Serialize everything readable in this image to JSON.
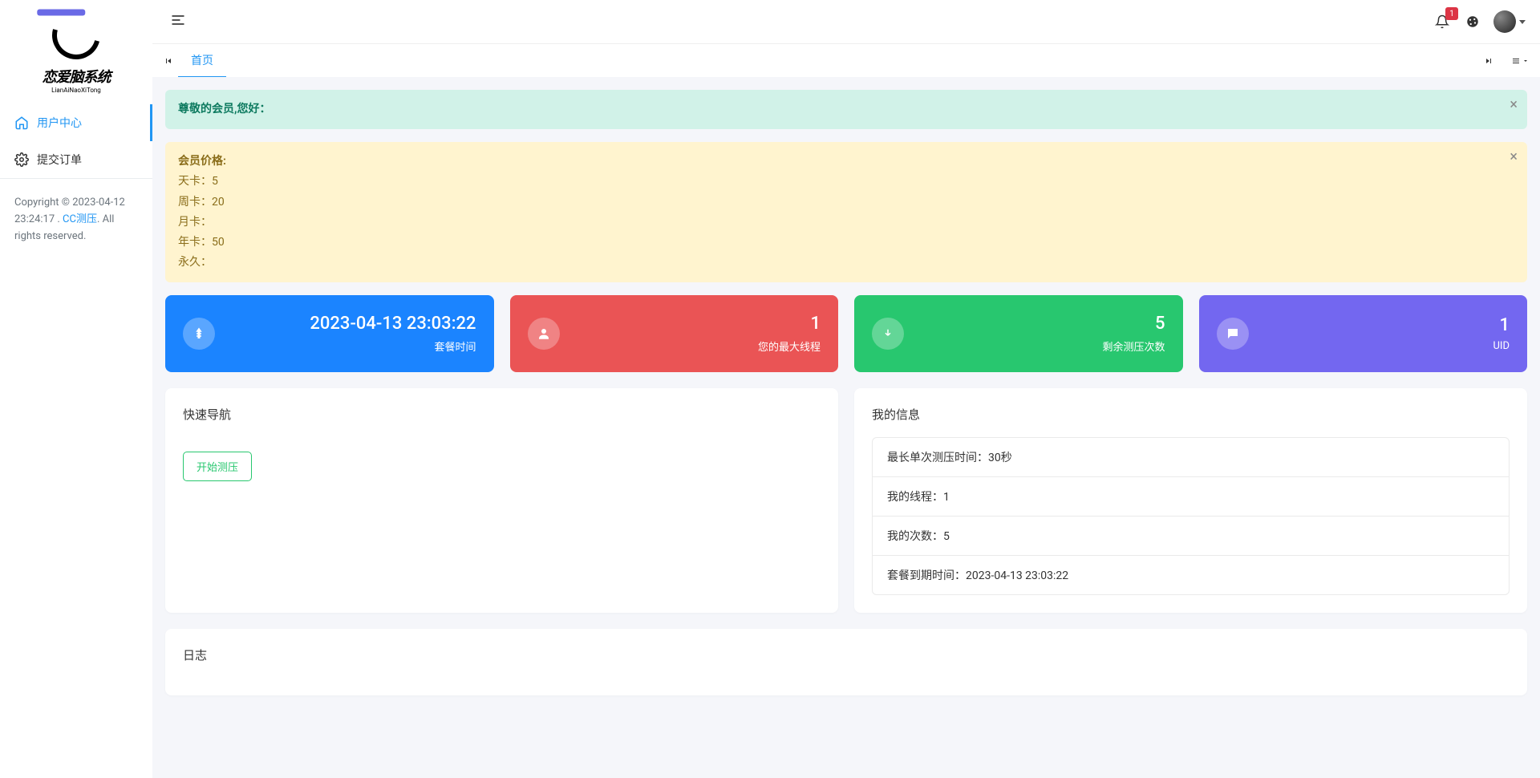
{
  "sidebar": {
    "logo_text": "恋爱脑系统",
    "logo_sub": "LianAiNaoXiTong",
    "items": [
      {
        "label": "用户中心",
        "icon": "home-icon"
      },
      {
        "label": "提交订单",
        "icon": "gear-icon"
      }
    ],
    "footer": {
      "prefix": "Copyright © 2023-04-12 23:24:17 . ",
      "link_text": "CC测压",
      "suffix": ". All rights reserved."
    }
  },
  "header": {
    "notification_badge": "1"
  },
  "tabs": {
    "items": [
      {
        "label": "首页",
        "active": true
      }
    ]
  },
  "alerts": {
    "greeting": "尊敬的会员,您好：",
    "pricing": {
      "title": "会员价格:",
      "lines": [
        {
          "label": "天卡：",
          "value": "5"
        },
        {
          "label": "周卡：",
          "value": "20"
        },
        {
          "label": "月卡：",
          "value": ""
        },
        {
          "label": "年卡：",
          "value": "50"
        },
        {
          "label": "永久：",
          "value": ""
        }
      ]
    }
  },
  "stats": [
    {
      "value": "2023-04-13 23:03:22",
      "label": "套餐时间",
      "icon": "yen-icon",
      "color": "blue"
    },
    {
      "value": "1",
      "label": "您的最大线程",
      "icon": "user-icon",
      "color": "red"
    },
    {
      "value": "5",
      "label": "剩余测压次数",
      "icon": "download-icon",
      "color": "green"
    },
    {
      "value": "1",
      "label": "UID",
      "icon": "message-icon",
      "color": "purple"
    }
  ],
  "quick_nav": {
    "title": "快速导航",
    "button_label": "开始测压"
  },
  "my_info": {
    "title": "我的信息",
    "items": [
      {
        "label": "最长单次测压时间：",
        "value": "30秒"
      },
      {
        "label": "我的线程：",
        "value": "1"
      },
      {
        "label": "我的次数：",
        "value": "5"
      },
      {
        "label": "套餐到期时间：",
        "value": "2023-04-13 23:03:22"
      }
    ]
  },
  "log": {
    "title": "日志"
  }
}
